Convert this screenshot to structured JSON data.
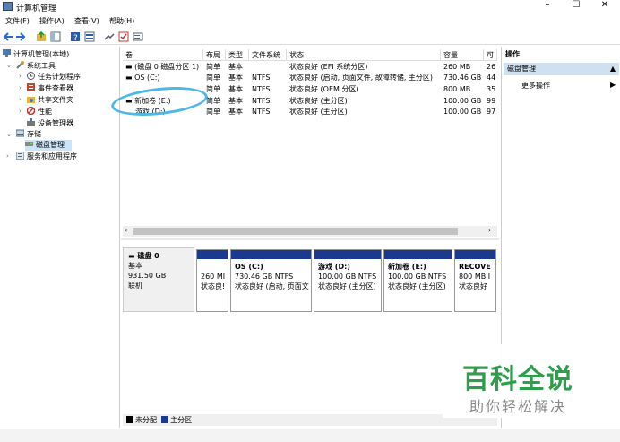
{
  "window": {
    "title": "计算机管理",
    "min": "–",
    "max": "☐",
    "close": "✕"
  },
  "menu": [
    "文件(F)",
    "操作(A)",
    "查看(V)",
    "帮助(H)"
  ],
  "tree": {
    "root": "计算机管理(本地)",
    "system_tools": "系统工具",
    "task_scheduler": "任务计划程序",
    "event_viewer": "事件查看器",
    "shared_folders": "共享文件夹",
    "performance": "性能",
    "device_manager": "设备管理器",
    "storage": "存储",
    "disk_management": "磁盘管理",
    "services_apps": "服务和应用程序"
  },
  "volumes": {
    "columns": [
      "卷",
      "布局",
      "类型",
      "文件系统",
      "状态",
      "容量",
      "可"
    ],
    "rows": [
      {
        "name": "(磁盘 0 磁盘分区 1)",
        "layout": "简单",
        "type": "基本",
        "fs": "",
        "status": "状态良好 (EFI 系统分区)",
        "cap": "260 MB",
        "free": "26"
      },
      {
        "name": "OS (C:)",
        "layout": "简单",
        "type": "基本",
        "fs": "NTFS",
        "status": "状态良好 (启动, 页面文件, 故障转储, 主分区)",
        "cap": "730.46 GB",
        "free": "44"
      },
      {
        "name": "",
        "layout": "简单",
        "type": "基本",
        "fs": "NTFS",
        "status": "状态良好 (OEM 分区)",
        "cap": "800 MB",
        "free": "35"
      },
      {
        "name": "新加卷 (E:)",
        "layout": "简单",
        "type": "基本",
        "fs": "NTFS",
        "status": "状态良好 (主分区)",
        "cap": "100.00 GB",
        "free": "99"
      },
      {
        "name": "游戏 (D:)",
        "layout": "简单",
        "type": "基本",
        "fs": "NTFS",
        "status": "状态良好 (主分区)",
        "cap": "100.00 GB",
        "free": "97"
      }
    ]
  },
  "disk": {
    "name": "磁盘 0",
    "kind": "基本",
    "size": "931.50 GB",
    "state": "联机"
  },
  "partitions": [
    {
      "title": "",
      "size": "260 MI",
      "status": "状态良!"
    },
    {
      "title": "OS  (C:)",
      "size": "730.46 GB NTFS",
      "status": "状态良好 (启动, 页面文"
    },
    {
      "title": "游戏  (D:)",
      "size": "100.00 GB NTFS",
      "status": "状态良好 (主分区)"
    },
    {
      "title": "新加卷  (E:)",
      "size": "100.00 GB NTFS",
      "status": "状态良好 (主分区)"
    },
    {
      "title": "RECOVE",
      "size": "800 MB I",
      "status": "状态良好"
    }
  ],
  "legend": {
    "unalloc": "未分配",
    "primary": "主分区"
  },
  "actions": {
    "header": "操作",
    "selected": "磁盘管理",
    "more": "更多操作"
  },
  "watermark": {
    "big": "百科全说",
    "small": "助你轻松解决"
  },
  "colors": {
    "partition_bar": "#1a3a8f",
    "accent_circle": "#4db8e8",
    "watermark": "#2e9e4a"
  }
}
